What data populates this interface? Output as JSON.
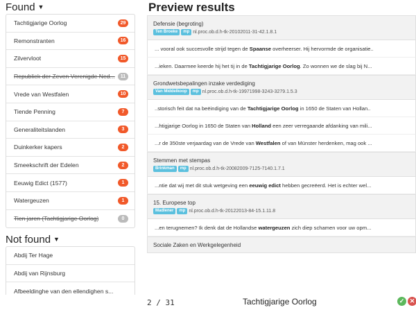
{
  "found": {
    "title": "Found",
    "items": [
      {
        "label": "Tachtigjarige Oorlog",
        "count": "29",
        "struck": false
      },
      {
        "label": "Remonstranten",
        "count": "16",
        "struck": false
      },
      {
        "label": "Zilvervloot",
        "count": "15",
        "struck": false
      },
      {
        "label": "Republiek der Zeven Verenigde Ned...",
        "count": "11",
        "struck": true
      },
      {
        "label": "Vrede van Westfalen",
        "count": "10",
        "struck": false
      },
      {
        "label": "Tiende Penning",
        "count": "7",
        "struck": false
      },
      {
        "label": "Generaliteitslanden",
        "count": "3",
        "struck": false
      },
      {
        "label": "Duinkerker kapers",
        "count": "2",
        "struck": false
      },
      {
        "label": "Smeekschrift der Edelen",
        "count": "2",
        "struck": false
      },
      {
        "label": "Eeuwig Edict (1577)",
        "count": "1",
        "struck": false
      },
      {
        "label": "Watergeuzen",
        "count": "1",
        "struck": false
      },
      {
        "label": "Tien jaren (Tachtigjarige Oorlog)",
        "count": "0",
        "struck": true
      }
    ]
  },
  "not_found": {
    "title": "Not found",
    "items": [
      {
        "label": "Abdij Ter Hage"
      },
      {
        "label": "Abdij van Rijnsburg"
      },
      {
        "label": "Afbeeldinghe van den ellendighen s..."
      }
    ]
  },
  "preview": {
    "title": "Preview results",
    "results": [
      {
        "title": "Defensie (begroting)",
        "tag1": "Ten Broeke",
        "tag2": "mp",
        "id": "nl.proc.ob.d.h-tk-20102011-31-42.1.8.1",
        "snippets": [
          {
            "pre": "... vooral ook succesvolle strijd tegen de ",
            "hit": "Spaanse",
            "post": " overheerser. Hij hervormde de organisatie.."
          },
          {
            "pre": "...ieken. Daarmee keerde hij het tij in de ",
            "hit": "Tachtigjarige Oorlog",
            "post": ". Zo wonnen we de slag bij N..."
          }
        ]
      },
      {
        "title": "Grondwetsbepalingen inzake verdediging",
        "tag1": "Van Middelkoop",
        "tag2": "mp",
        "id": "nl.proc.ob.d.h-tk-19971998-3243-3279.1.5.3",
        "snippets": [
          {
            "pre": "..storisch feit dat na beëindiging van de ",
            "hit": "Tachtigjarige Oorlog",
            "post": " in 1650 de Staten van Hollan.."
          },
          {
            "pre": "...htigjarige Oorlog in 1650 de Staten van ",
            "hit": "Holland",
            "post": " een zeer verregaande afdanking van mili..."
          },
          {
            "pre": "...r de 350ste verjaardag van de Vrede van ",
            "hit": "Westfalen",
            "post": " of van Münster herdenken, mag ook ..."
          }
        ]
      },
      {
        "title": "Stemmen met stempas",
        "tag1": "Brinkman",
        "tag2": "mp",
        "id": "nl.proc.ob.d.h-tk-20082009-7125-7140.1.7.1",
        "snippets": [
          {
            "pre": "...ntie dat wij met dit stuk wetgeving een ",
            "hit": "eeuwig edict",
            "post": " hebben gecreëerd. Het is echter wel..."
          }
        ]
      },
      {
        "title": "15. Europese top",
        "tag1": "Madlener",
        "tag2": "mp",
        "id": "nl.proc.ob.d.h-tk-20122013-84-15.1.11.8",
        "snippets": [
          {
            "pre": "...en terugnemen? Ik denk dat de Hollandse ",
            "hit": "watergeuzen",
            "post": " zich diep schamen voor uw opm..."
          }
        ]
      },
      {
        "title": "Sociale Zaken en Werkgelegenheid",
        "tag1": "",
        "tag2": "",
        "id": "",
        "snippets": []
      }
    ]
  },
  "footer": {
    "counter": "2 / 31",
    "current_term": "Tachtigjarige Oorlog",
    "accept_icon": "check-icon",
    "reject_icon": "close-icon"
  },
  "colors": {
    "badge": "#f1592a",
    "badge_zero": "#bbbbbb",
    "tag": "#5bc0de",
    "accept": "#5cb85c",
    "reject": "#d9534f"
  }
}
